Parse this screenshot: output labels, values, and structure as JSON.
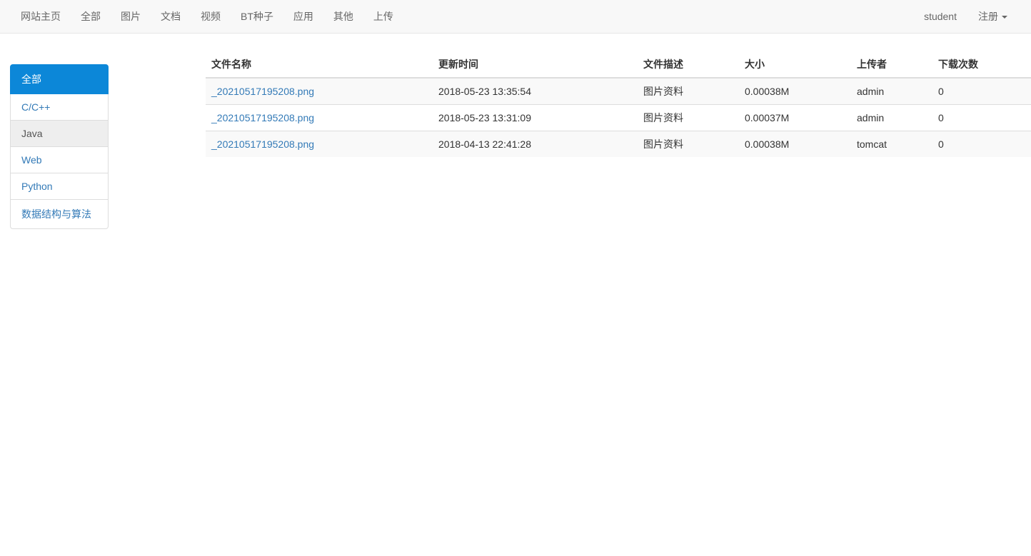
{
  "navbar": {
    "items": [
      {
        "label": "网站主页"
      },
      {
        "label": "全部"
      },
      {
        "label": "图片"
      },
      {
        "label": "文档"
      },
      {
        "label": "视频"
      },
      {
        "label": "BT种子"
      },
      {
        "label": "应用"
      },
      {
        "label": "其他"
      },
      {
        "label": "上传"
      }
    ],
    "right": {
      "username": "student",
      "register_label": "注册",
      "caret_icon": "caret-down"
    }
  },
  "sidebar": {
    "items": [
      {
        "label": "全部",
        "state": "active"
      },
      {
        "label": "C/C++",
        "state": "normal"
      },
      {
        "label": "Java",
        "state": "hovered"
      },
      {
        "label": "Web",
        "state": "normal"
      },
      {
        "label": "Python",
        "state": "normal"
      },
      {
        "label": "数据结构与算法",
        "state": "normal"
      }
    ]
  },
  "table": {
    "columns": [
      "文件名称",
      "更新时间",
      "文件描述",
      "大小",
      "上传者",
      "下载次数"
    ],
    "rows": [
      {
        "name": "_20210517195208.png",
        "updated": "2018-05-23 13:35:54",
        "description": "图片资料",
        "size": "0.00038M",
        "uploader": "admin",
        "downloads": "0"
      },
      {
        "name": "_20210517195208.png",
        "updated": "2018-05-23 13:31:09",
        "description": "图片资料",
        "size": "0.00037M",
        "uploader": "admin",
        "downloads": "0"
      },
      {
        "name": "_20210517195208.png",
        "updated": "2018-04-13 22:41:28",
        "description": "图片资料",
        "size": "0.00038M",
        "uploader": "tomcat",
        "downloads": "0"
      }
    ]
  },
  "colors": {
    "accent_blue": "#0c87d8",
    "link_blue": "#337ab7",
    "navbar_bg": "#f8f8f8",
    "navbar_border": "#e7e7e7",
    "stripe_bg": "#f9f9f9",
    "hover_bg": "#eeeeee"
  }
}
